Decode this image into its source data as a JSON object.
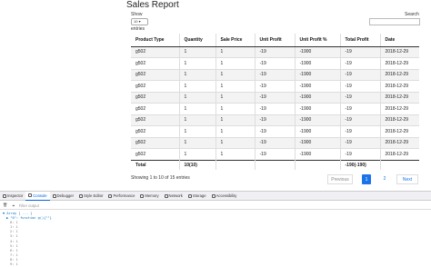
{
  "page": {
    "title": "Sales Report"
  },
  "controls": {
    "show_label": "Show",
    "page_length": "10",
    "entries_label": "entries",
    "search_label": "Search"
  },
  "table": {
    "headers": [
      "Product Type",
      "Quantity",
      "Sale Price",
      "Unit Profit",
      "Unit Profit %",
      "Total Profit",
      "Date"
    ],
    "rows": [
      [
        "g502",
        "1",
        "1",
        "-19",
        "-1900",
        "-19",
        "2018-12-29"
      ],
      [
        "g502",
        "1",
        "1",
        "-19",
        "-1900",
        "-19",
        "2018-12-29"
      ],
      [
        "g502",
        "1",
        "1",
        "-19",
        "-1900",
        "-19",
        "2018-12-29"
      ],
      [
        "g502",
        "1",
        "1",
        "-19",
        "-1900",
        "-19",
        "2018-12-29"
      ],
      [
        "g502",
        "1",
        "1",
        "-19",
        "-1900",
        "-19",
        "2018-12-29"
      ],
      [
        "g502",
        "1",
        "1",
        "-19",
        "-1900",
        "-19",
        "2018-12-29"
      ],
      [
        "g502",
        "1",
        "1",
        "-19",
        "-1900",
        "-19",
        "2018-12-29"
      ],
      [
        "g502",
        "1",
        "1",
        "-19",
        "-1900",
        "-19",
        "2018-12-29"
      ],
      [
        "g502",
        "1",
        "1",
        "-19",
        "-1900",
        "-19",
        "2018-12-29"
      ],
      [
        "g502",
        "1",
        "1",
        "-19",
        "-1900",
        "-19",
        "2018-12-29"
      ]
    ],
    "footer": [
      "Total",
      "10(10)",
      "",
      "",
      "",
      "-190(-190)",
      ""
    ]
  },
  "pagination": {
    "info": "Showing 1 to 10 of 15 entries",
    "previous": "Previous",
    "page1": "1",
    "page2": "2",
    "next": "Next",
    "active_color": "#1a73e8"
  },
  "devtools": {
    "tabs": [
      {
        "label": "Inspector",
        "icon": "inspector-icon"
      },
      {
        "label": "Console",
        "icon": "console-icon"
      },
      {
        "label": "Debugger",
        "icon": "debugger-icon"
      },
      {
        "label": "Style Editor",
        "icon": "style-editor-icon"
      },
      {
        "label": "Performance",
        "icon": "performance-icon"
      },
      {
        "label": "Memory",
        "icon": "memory-icon"
      },
      {
        "label": "Network",
        "icon": "network-icon"
      },
      {
        "label": "Storage",
        "icon": "storage-icon"
      },
      {
        "label": "Accessibility",
        "icon": "accessibility-icon"
      }
    ],
    "active_tab": "Console",
    "filter_placeholder": "Filter output",
    "console_lines": [
      "▼ Array [ ... ]",
      "▶ \"0\": function g(){\"\"}",
      "0: 1",
      "1: 1",
      "2: 1",
      "3: 1",
      "4: 1",
      "5: 1",
      "6: 1",
      "7: 1",
      "8: 1",
      "9: 1",
      "▶ Object { __dt_wrapper: true, json: g(){\"\"}, params: g(){\"\"}, ... }"
    ]
  }
}
